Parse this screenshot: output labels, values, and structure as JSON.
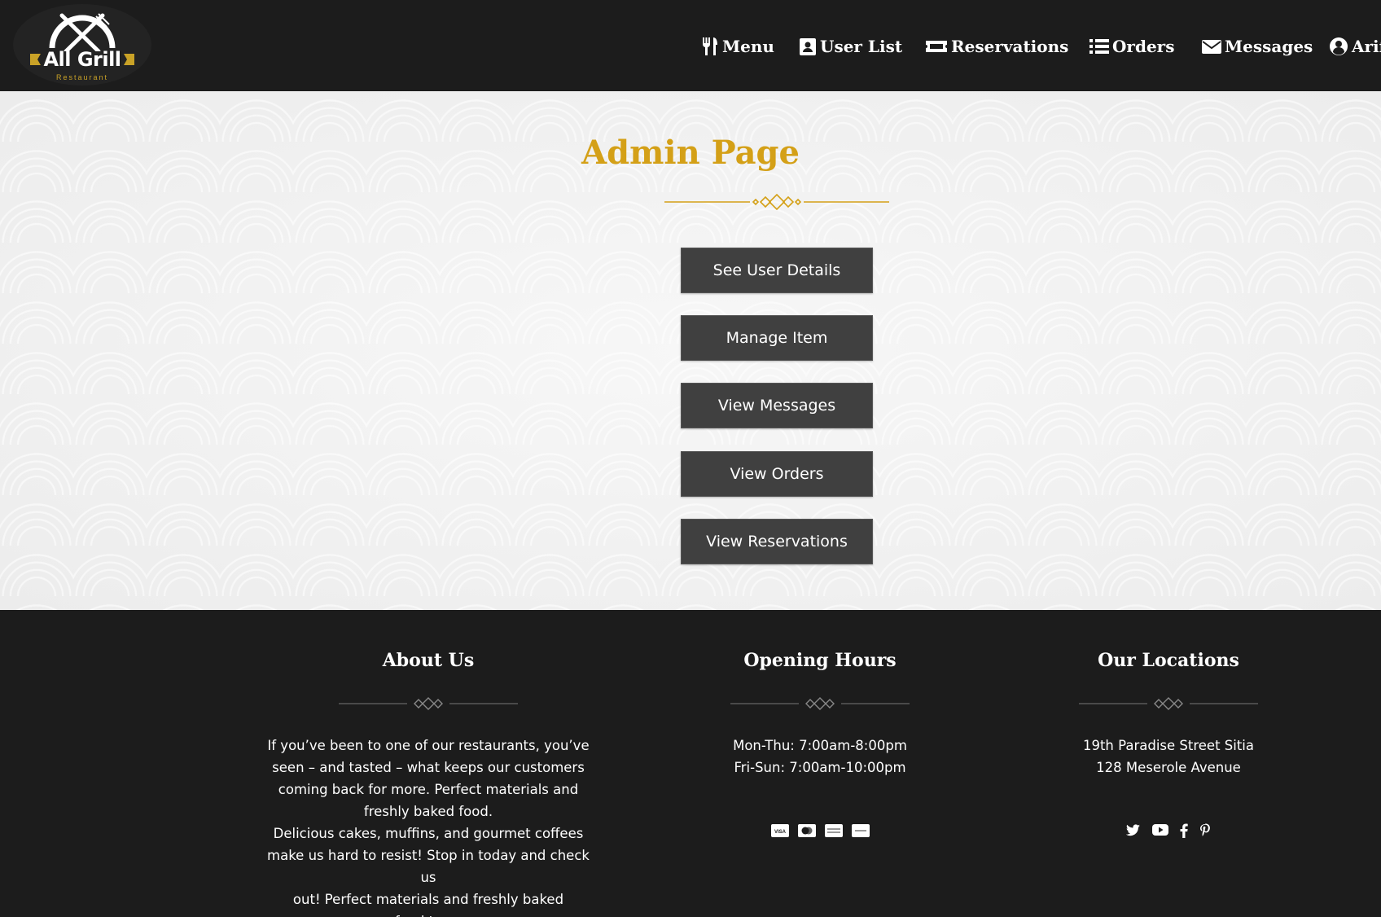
{
  "brand": {
    "name": "All Grill",
    "subtitle": "Restaurant"
  },
  "nav": {
    "items": [
      {
        "label": "Menu",
        "icon": "utensils-icon"
      },
      {
        "label": "User List",
        "icon": "user-card-icon"
      },
      {
        "label": "Reservations",
        "icon": "ticket-icon"
      },
      {
        "label": "Orders",
        "icon": "list-icon"
      },
      {
        "label": "Messages",
        "icon": "envelope-icon"
      },
      {
        "label": "Arif",
        "icon": "user-circle-icon"
      }
    ]
  },
  "main": {
    "title": "Admin Page",
    "buttons": [
      "See User Details",
      "Manage Item",
      "View Messages",
      "View Orders",
      "View Reservations"
    ]
  },
  "footer": {
    "about": {
      "title": "About Us",
      "lines": [
        "If you’ve been to one of our restaurants, you’ve",
        "seen – and tasted – what keeps our customers",
        "coming back for more. Perfect materials and",
        "freshly baked food.",
        "Delicious cakes, muffins, and gourmet coffees",
        "make us hard to resist! Stop in today and check us",
        "out! Perfect materials and freshly baked",
        "food.town"
      ]
    },
    "hours": {
      "title": "Opening Hours",
      "lines": [
        "Mon-Thu: 7:00am-8:00pm",
        "Fri-Sun: 7:00am-10:00pm"
      ],
      "payment_icons": [
        "visa-icon",
        "mastercard-icon",
        "amex-icon",
        "paypal-icon"
      ]
    },
    "locations": {
      "title": "Our Locations",
      "lines": [
        "19th Paradise Street Sitia",
        "128 Meserole Avenue"
      ],
      "social_icons": [
        "twitter-icon",
        "youtube-icon",
        "facebook-icon",
        "pinterest-icon"
      ]
    }
  },
  "colors": {
    "accent": "#d4a017",
    "dark": "#1c1c1c",
    "button": "#404040"
  }
}
